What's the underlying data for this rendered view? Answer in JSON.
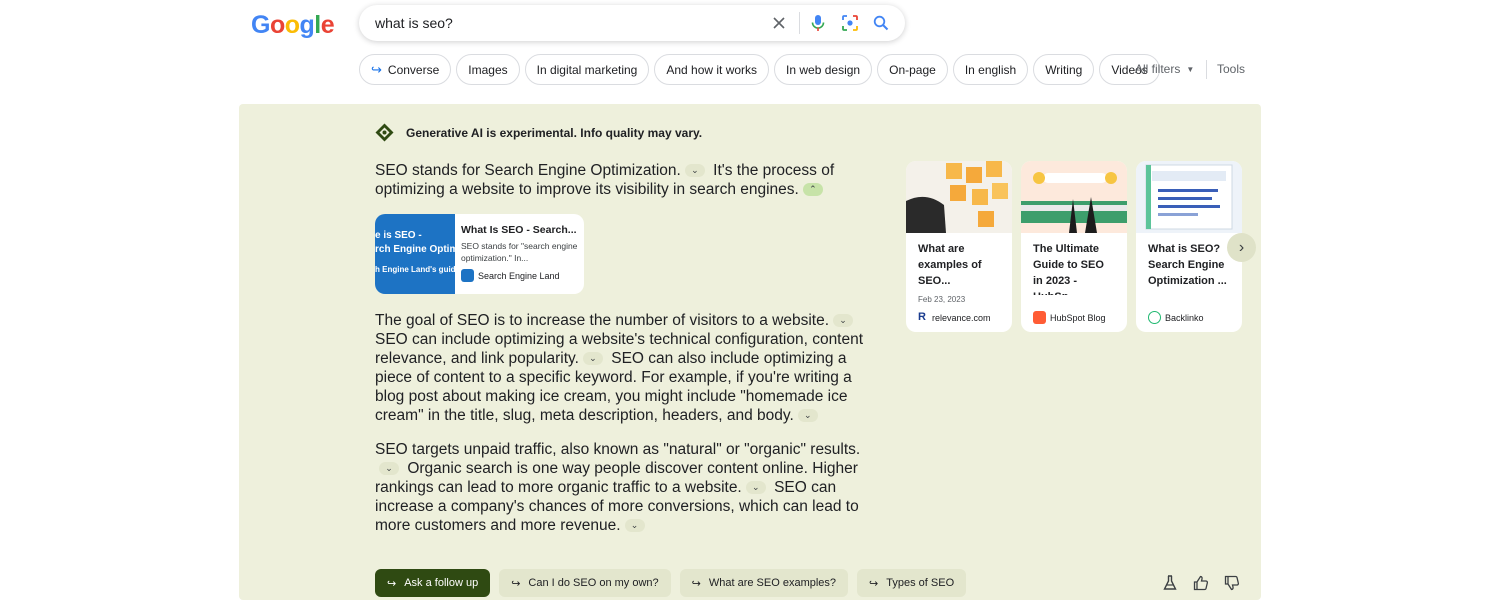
{
  "header": {
    "logo_letters": [
      {
        "ch": "G",
        "color": "#4285F4"
      },
      {
        "ch": "o",
        "color": "#EA4335"
      },
      {
        "ch": "o",
        "color": "#FBBC05"
      },
      {
        "ch": "g",
        "color": "#4285F4"
      },
      {
        "ch": "l",
        "color": "#34A853"
      },
      {
        "ch": "e",
        "color": "#EA4335"
      }
    ],
    "search": {
      "value": "what is seo?",
      "icons": [
        "close-icon",
        "microphone-icon",
        "lens-icon",
        "search-icon"
      ]
    },
    "chips": [
      {
        "label": "Converse",
        "icon": "follow-up-arrow-icon"
      },
      {
        "label": "Images"
      },
      {
        "label": "In digital marketing"
      },
      {
        "label": "And how it works"
      },
      {
        "label": "In web design"
      },
      {
        "label": "On-page"
      },
      {
        "label": "In english"
      },
      {
        "label": "Writing"
      },
      {
        "label": "Videos"
      }
    ],
    "all_filters": "All filters",
    "tools": "Tools"
  },
  "sge": {
    "disclaimer": "Generative AI is experimental. Info quality may vary.",
    "para1": {
      "s1": "SEO stands for Search Engine Optimization.",
      "s2": "It's the process of optimizing a website to improve its visibility in search engines."
    },
    "source_card": {
      "thumb_lines": [
        "e is SEO -",
        "rch Engine Optimizatio",
        "h Engine Land's guide to SE"
      ],
      "title": "What Is SEO - Search...",
      "snippet": "SEO stands for \"search engine optimization.\" In...",
      "site": "Search Engine Land"
    },
    "para2": {
      "s1": "The goal of SEO is to increase the number of visitors to a website.",
      "s2": "SEO can include optimizing a website's technical configuration, content relevance, and link popularity.",
      "s3": "SEO can also include optimizing a piece of content to a specific keyword. For example, if you're writing a blog post about making ice cream, you might include \"homemade ice cream\" in the title, slug, meta description, headers, and body."
    },
    "para3": {
      "s1": "SEO targets unpaid traffic, also known as \"natural\" or \"organic\" results.",
      "s2": "Organic search is one way people discover content online. Higher rankings can lead to more organic traffic to a website.",
      "s3": "SEO can increase a company's chances of more conversions, which can lead to more customers and more revenue."
    },
    "cards": [
      {
        "title": "What are examples of SEO...",
        "date": "Feb 23, 2023",
        "site": "relevance.com",
        "fav_color": "#1a3c8f",
        "fav_text": "R"
      },
      {
        "title": "The Ultimate Guide to SEO in 2023 - HubSp...",
        "date": "",
        "site": "HubSpot Blog",
        "fav_color": "#ff5c35",
        "fav_text": "H"
      },
      {
        "title": "What is SEO? Search Engine Optimization ...",
        "date": "",
        "site": "Backlinko",
        "fav_color": "#1fb870",
        "fav_text": ""
      }
    ],
    "followups": [
      {
        "label": "Ask a follow up",
        "primary": true
      },
      {
        "label": "Can I do SEO on my own?"
      },
      {
        "label": "What are SEO examples?"
      },
      {
        "label": "Types of SEO"
      }
    ],
    "feedback_icons": [
      "flask-icon",
      "thumbs-up-icon",
      "thumbs-down-icon"
    ]
  }
}
